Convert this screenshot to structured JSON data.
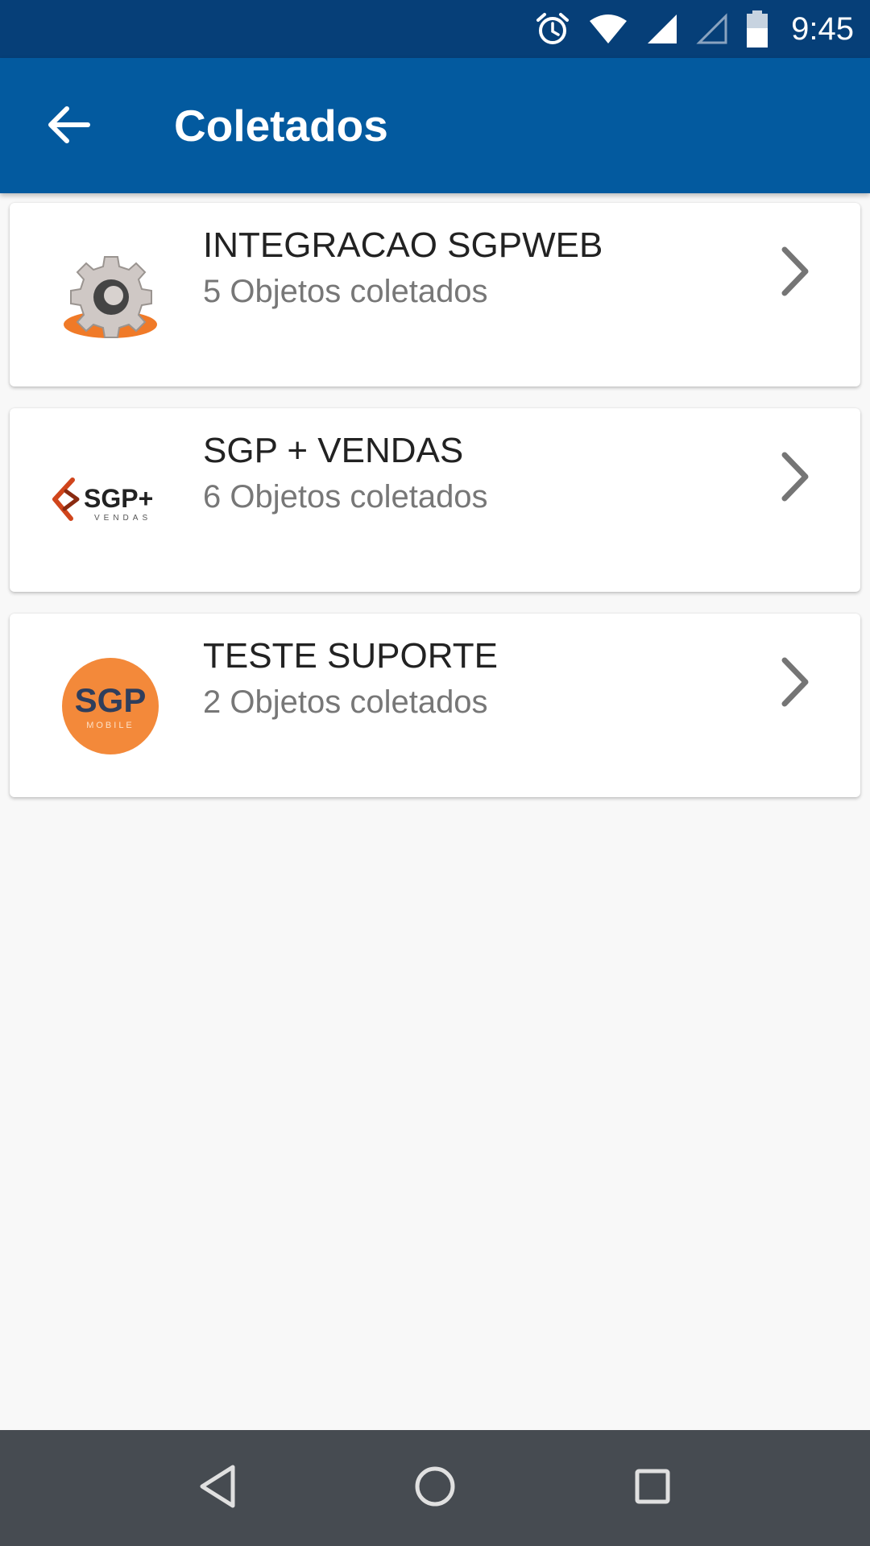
{
  "status_bar": {
    "time": "9:45",
    "icons": [
      "alarm-icon",
      "wifi-icon",
      "signal-icon",
      "signal-empty-icon",
      "battery-icon"
    ]
  },
  "app_bar": {
    "title": "Coletados",
    "back_icon": "arrow-back-icon",
    "color": "#035a9f"
  },
  "items": [
    {
      "title": "INTEGRACAO SGPWEB",
      "subtitle": "5 Objetos coletados",
      "logo": "gear-logo-icon"
    },
    {
      "title": "SGP + VENDAS",
      "subtitle": "6 Objetos coletados",
      "logo": "sgp-vendas-logo",
      "logo_text": "SGP+",
      "logo_subtext": "VENDAS"
    },
    {
      "title": "TESTE SUPORTE",
      "subtitle": "2 Objetos coletados",
      "logo": "sgp-mobile-logo",
      "logo_text": "SGP",
      "logo_subtext": "MOBILE"
    }
  ],
  "nav_bar": {
    "icons": [
      "back-triangle-icon",
      "home-circle-icon",
      "recents-square-icon"
    ]
  }
}
